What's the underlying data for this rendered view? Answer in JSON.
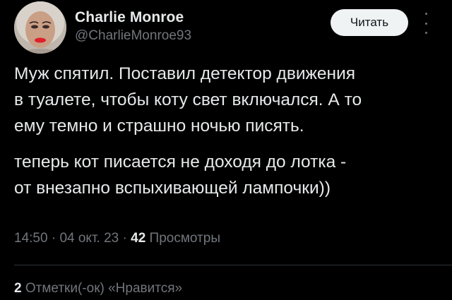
{
  "author": {
    "name": "Charlie Monroe",
    "handle": "@CharlieMonroe93"
  },
  "follow_button": {
    "label": "Читать"
  },
  "tweet": {
    "paragraph1_lines": [
      "Муж спятил. Поставил детектор движения",
      "в туалете, чтобы коту свет включался. А то",
      "ему темно и страшно ночью писять."
    ],
    "paragraph2_lines": [
      "теперь кот писается не доходя до лотка -",
      "от внезапно вспыхивающей лампочки))"
    ]
  },
  "meta": {
    "time": "14:50",
    "separator": "·",
    "date": "04 окт. 23",
    "views_count": "42",
    "views_label": "Просмотры"
  },
  "stats": {
    "likes_count": "2",
    "likes_label": "Отметки(-ок) «Нравится»"
  },
  "icons": {
    "more": "more-vertical-icon"
  },
  "colors": {
    "background": "#000000",
    "primary_text": "#e7e9ea",
    "secondary_text": "#71767b",
    "button_bg": "#eff3f4",
    "divider": "#2f3336"
  }
}
